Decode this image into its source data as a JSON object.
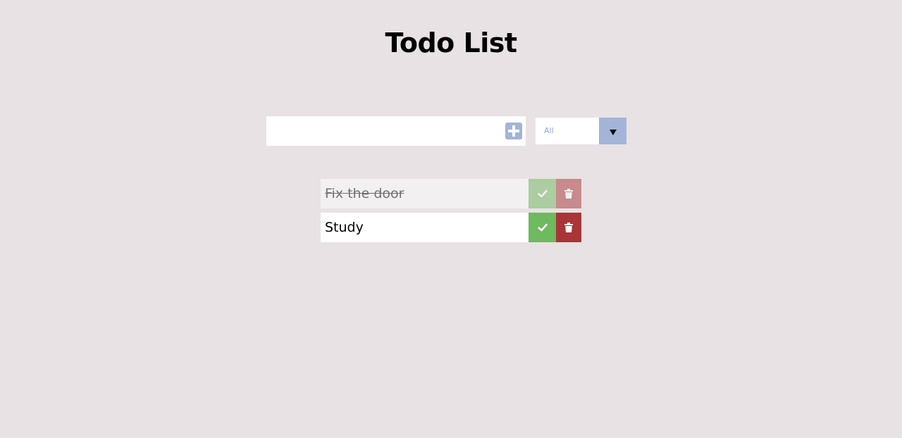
{
  "header": {
    "title": "Todo List"
  },
  "form": {
    "input_value": "",
    "input_placeholder": "",
    "add_icon": "plus-square-icon"
  },
  "filter": {
    "selected": "All",
    "arrow_icon": "caret-down-icon"
  },
  "todos": [
    {
      "text": "Fix the door",
      "completed": true
    },
    {
      "text": "Study",
      "completed": false
    }
  ],
  "icons": {
    "complete": "check-icon",
    "delete": "trash-icon"
  },
  "colors": {
    "background": "#e8e2e4",
    "accent": "#a3b4d8",
    "complete": "#6fb95f",
    "delete": "#a93537"
  }
}
